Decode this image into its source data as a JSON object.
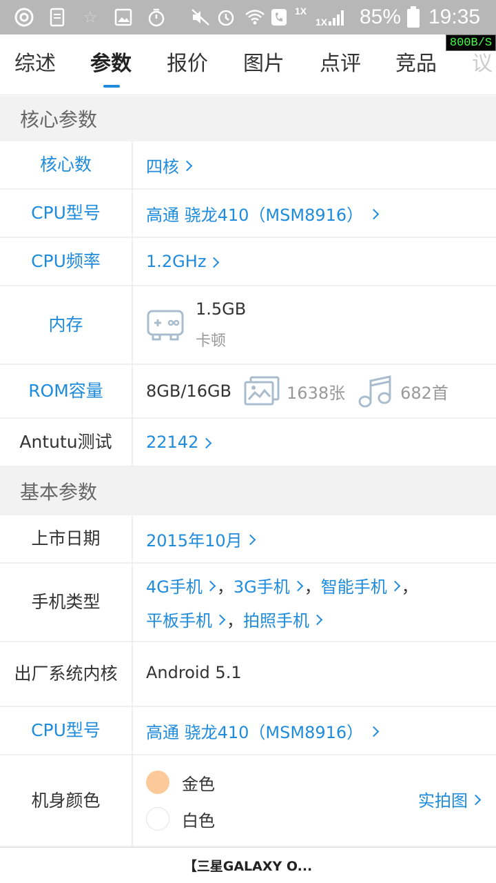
{
  "status_bar": {
    "battery": "85%",
    "time": "19:35",
    "signal_a": "1X",
    "signal_b": "1X",
    "net_speed": "800B/S"
  },
  "tabs": [
    "综述",
    "参数",
    "报价",
    "图片",
    "点评",
    "竞品",
    "议"
  ],
  "active_tab_index": 1,
  "sections": {
    "core": "核心参数",
    "basic": "基本参数"
  },
  "core": {
    "cores_label": "核心数",
    "cores_value": "四核",
    "cpu_model_label": "CPU型号",
    "cpu_model_value": "高通 骁龙410（MSM8916）",
    "cpu_freq_label": "CPU频率",
    "cpu_freq_value": "1.2GHz",
    "ram_label": "内存",
    "ram_value": "1.5GB",
    "ram_note": "卡顿",
    "rom_label": "ROM容量",
    "rom_value": "8GB/16GB",
    "rom_photos": "1638张",
    "rom_songs": "682首",
    "antutu_label": "Antutu测试",
    "antutu_value": "22142"
  },
  "basic": {
    "release_label": "上市日期",
    "release_value": "2015年10月",
    "type_label": "手机类型",
    "types": [
      "4G手机",
      "3G手机",
      "智能手机",
      "平板手机",
      "拍照手机"
    ],
    "separator": "，",
    "os_label": "出厂系统内核",
    "os_value": "Android 5.1",
    "cpu_model_label": "CPU型号",
    "cpu_model_value": "高通 骁龙410（MSM8916）",
    "color_label": "机身颜色",
    "colors": [
      {
        "name": "金色",
        "hex": "#fcc99a"
      },
      {
        "name": "白色",
        "hex": "#ffffff"
      }
    ],
    "real_photo": "实拍图"
  },
  "footer": {
    "title": "【三星GALAXY O..."
  },
  "colors": {
    "accent": "#1e8bdc",
    "section_bg": "#f2f2f2",
    "status_bar": "#b7b7b7"
  }
}
